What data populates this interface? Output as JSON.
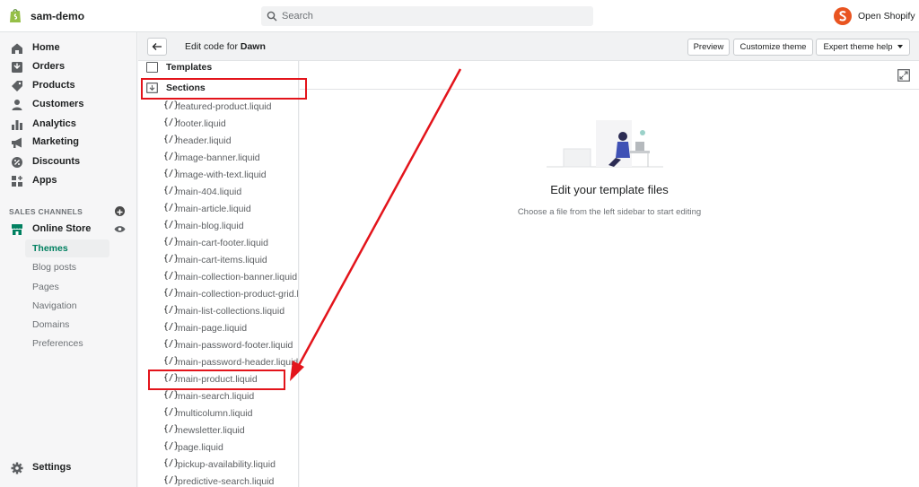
{
  "topbar": {
    "store_name": "sam-demo",
    "search_placeholder": "Search",
    "open_shop": "Open Shopify"
  },
  "sidebar": {
    "items": [
      {
        "label": "Home",
        "icon": "home-icon"
      },
      {
        "label": "Orders",
        "icon": "orders-icon"
      },
      {
        "label": "Products",
        "icon": "tag-icon"
      },
      {
        "label": "Customers",
        "icon": "person-icon"
      },
      {
        "label": "Analytics",
        "icon": "bar-chart-icon"
      },
      {
        "label": "Marketing",
        "icon": "megaphone-icon"
      },
      {
        "label": "Discounts",
        "icon": "discount-icon"
      },
      {
        "label": "Apps",
        "icon": "apps-icon"
      }
    ],
    "sales_channels_title": "SALES CHANNELS",
    "online_store": "Online Store",
    "sub_items": [
      "Themes",
      "Blog posts",
      "Pages",
      "Navigation",
      "Domains",
      "Preferences"
    ],
    "settings": "Settings"
  },
  "header": {
    "edit_prefix": "Edit code for",
    "theme_name": "Dawn",
    "preview": "Preview",
    "customize": "Customize theme",
    "expert_help": "Expert theme help"
  },
  "filetree": {
    "templates": "Templates",
    "sections": "Sections",
    "file_icon": "{/}",
    "files": [
      "featured-product.liquid",
      "footer.liquid",
      "header.liquid",
      "image-banner.liquid",
      "image-with-text.liquid",
      "main-404.liquid",
      "main-article.liquid",
      "main-blog.liquid",
      "main-cart-footer.liquid",
      "main-cart-items.liquid",
      "main-collection-banner.liquid",
      "main-collection-product-grid.l",
      "main-list-collections.liquid",
      "main-page.liquid",
      "main-password-footer.liquid",
      "main-password-header.liquid",
      "main-product.liquid",
      "main-search.liquid",
      "multicolumn.liquid",
      "newsletter.liquid",
      "page.liquid",
      "pickup-availability.liquid",
      "predictive-search.liquid"
    ]
  },
  "editor": {
    "empty_title": "Edit your template files",
    "empty_subtitle": "Choose a file from the left sidebar to start editing"
  },
  "colors": {
    "accent_green": "#008060",
    "annotation_red": "#e3141b"
  }
}
